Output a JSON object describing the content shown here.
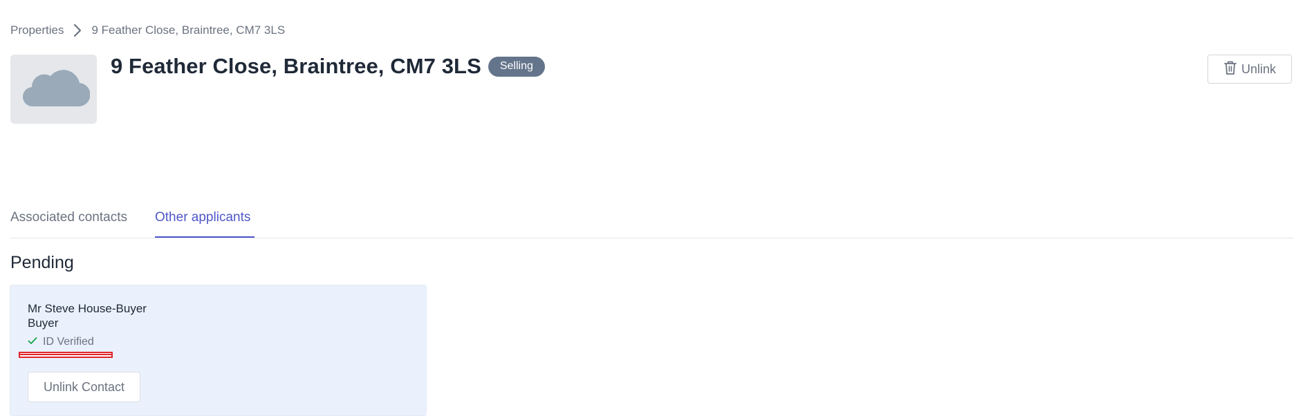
{
  "breadcrumb": {
    "root": "Properties",
    "current": "9 Feather Close, Braintree, CM7 3LS",
    "separator_icon": "chevron-right-icon"
  },
  "property": {
    "thumbnail_icon": "cloud-icon",
    "title": "9 Feather Close, Braintree, CM7 3LS",
    "status": "Selling",
    "status_color": "#64748b"
  },
  "actions": {
    "unlink_label": "Unlink",
    "unlink_icon": "trash-icon"
  },
  "tabs": [
    {
      "label": "Associated contacts",
      "active": false
    },
    {
      "label": "Other applicants",
      "active": true
    }
  ],
  "section": {
    "title": "Pending"
  },
  "contact_card": {
    "name": "Mr Steve House-Buyer",
    "role": "Buyer",
    "verification": "ID Verified",
    "verification_icon": "check-icon",
    "verification_color": "#16a34a",
    "unlink_contact_label": "Unlink Contact"
  },
  "colors": {
    "accent": "#4f56c8",
    "card_background": "#eaf1fd",
    "annotation": "#e0252b"
  }
}
